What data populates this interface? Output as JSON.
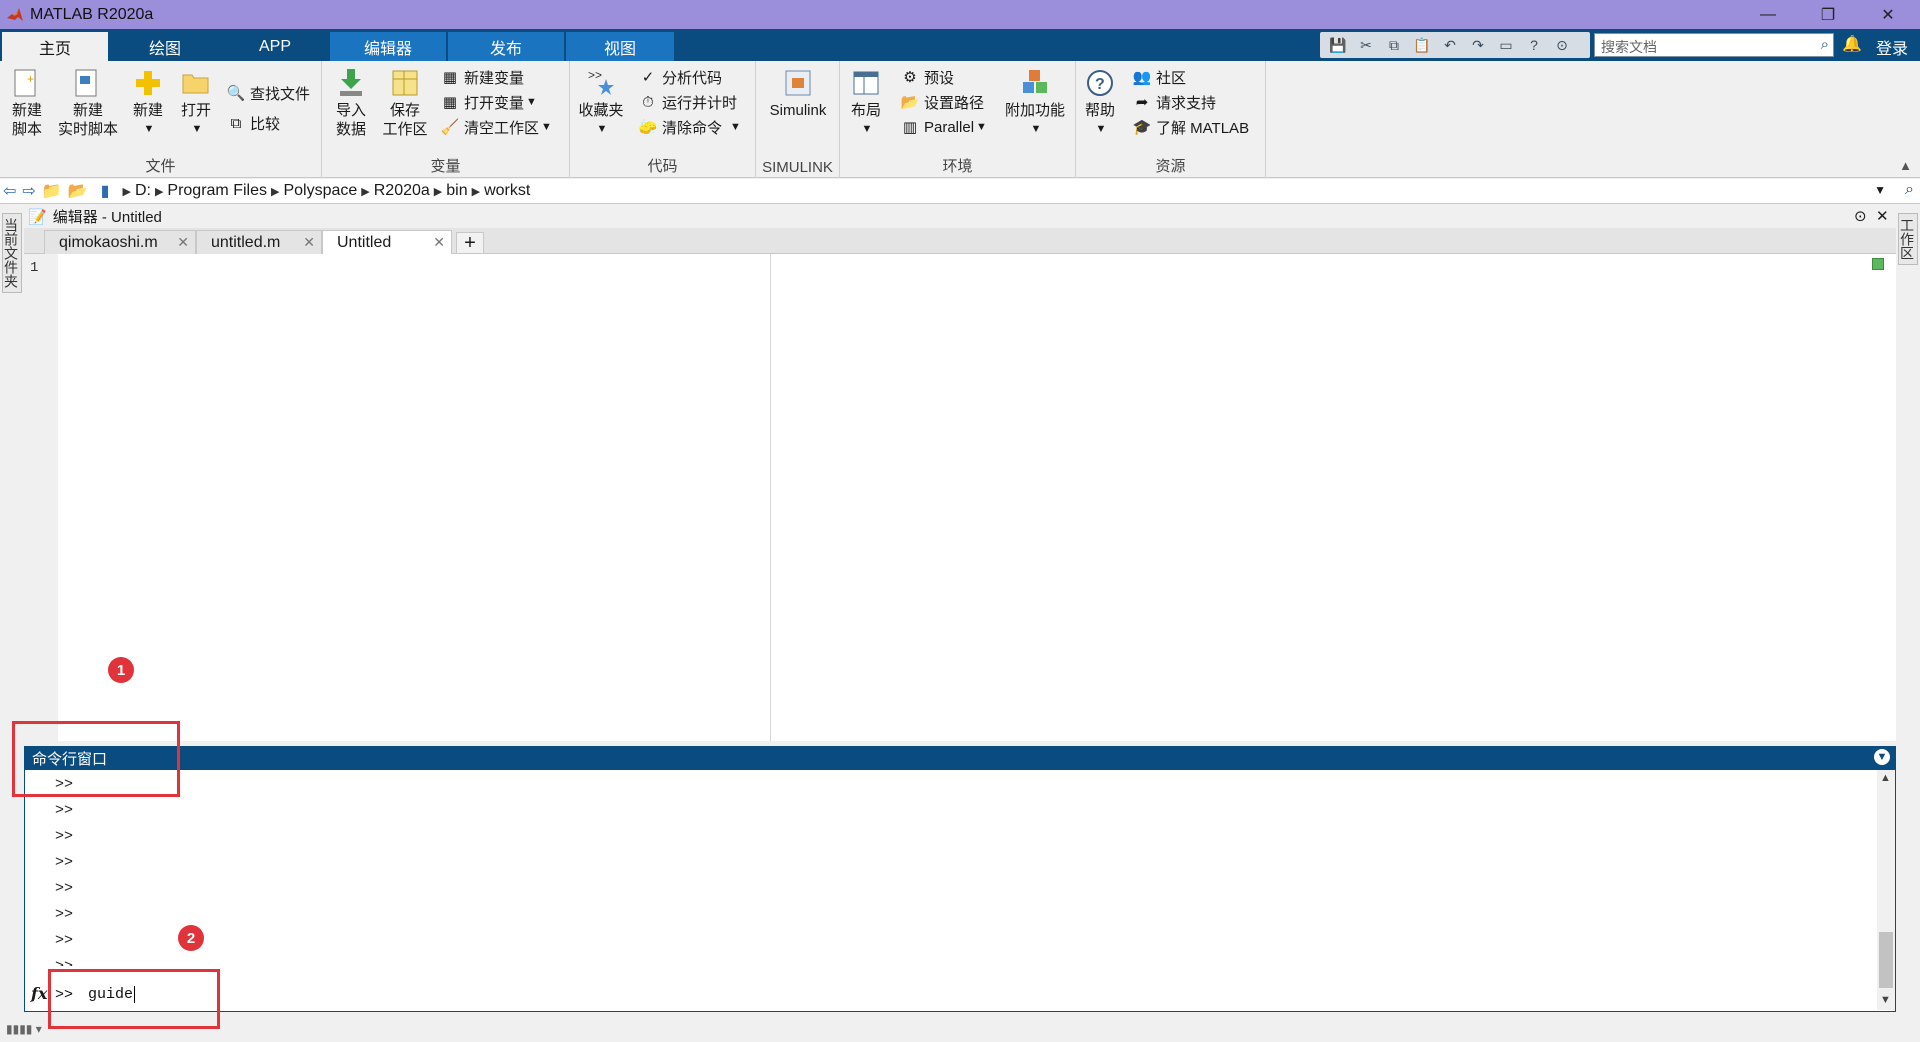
{
  "app": {
    "title": "MATLAB R2020a"
  },
  "window_controls": {
    "minimize": "—",
    "restore": "❐",
    "close": "✕"
  },
  "tabs": [
    {
      "label": "主页",
      "active": true
    },
    {
      "label": "绘图"
    },
    {
      "label": "APP"
    },
    {
      "label": "编辑器"
    },
    {
      "label": "发布"
    },
    {
      "label": "视图"
    }
  ],
  "search": {
    "placeholder": "搜索文档"
  },
  "login": "登录",
  "ribbon": {
    "file": {
      "label": "文件",
      "new_script": [
        "新建",
        "脚本"
      ],
      "new_live_script": [
        "新建",
        "实时脚本"
      ],
      "new": "新建",
      "open": "打开",
      "find_files": "查找文件",
      "compare": "比较"
    },
    "variable": {
      "label": "变量",
      "import_data": [
        "导入",
        "数据"
      ],
      "save_workspace": [
        "保存",
        "工作区"
      ],
      "new_variable": "新建变量",
      "open_variable": "打开变量",
      "clear_workspace": "清空工作区"
    },
    "code": {
      "label": "代码",
      "favorites": "收藏夹",
      "analyze_code": "分析代码",
      "run_and_time": "运行并计时",
      "clear_commands": "清除命令"
    },
    "simulink": {
      "label": "SIMULINK",
      "button": "Simulink"
    },
    "environment": {
      "label": "环境",
      "layout": "布局",
      "preferences": "预设",
      "set_path": "设置路径",
      "parallel": "Parallel",
      "addons": "附加功能"
    },
    "resources": {
      "label": "资源",
      "help": "帮助",
      "community": "社区",
      "request_support": "请求支持",
      "learn_matlab": "了解 MATLAB"
    }
  },
  "path": [
    "D:",
    "Program Files",
    "Polyspace",
    "R2020a",
    "bin",
    "workst"
  ],
  "side_panels": {
    "left": "当前文件夹",
    "right": "工作区"
  },
  "editor": {
    "title": "编辑器 - Untitled",
    "tabs": [
      {
        "label": "qimokaoshi.m"
      },
      {
        "label": "untitled.m"
      },
      {
        "label": "Untitled",
        "active": true
      }
    ],
    "add_tab": "+",
    "line_numbers": [
      "1"
    ]
  },
  "command_window": {
    "title": "命令行窗口",
    "history": [
      ">>",
      ">>",
      ">>",
      ">>",
      ">>",
      ">>",
      ">>",
      ">>"
    ],
    "fx": "fx",
    "prompt": ">>",
    "current_input": "guide"
  },
  "annotations": {
    "badge1": "1",
    "badge2": "2"
  },
  "colors": {
    "titlebar": "#9b8fdc",
    "tabstrip": "#0b4c80",
    "editor_tab_group": "#1a74bf",
    "annotation_red": "#e0333a"
  }
}
